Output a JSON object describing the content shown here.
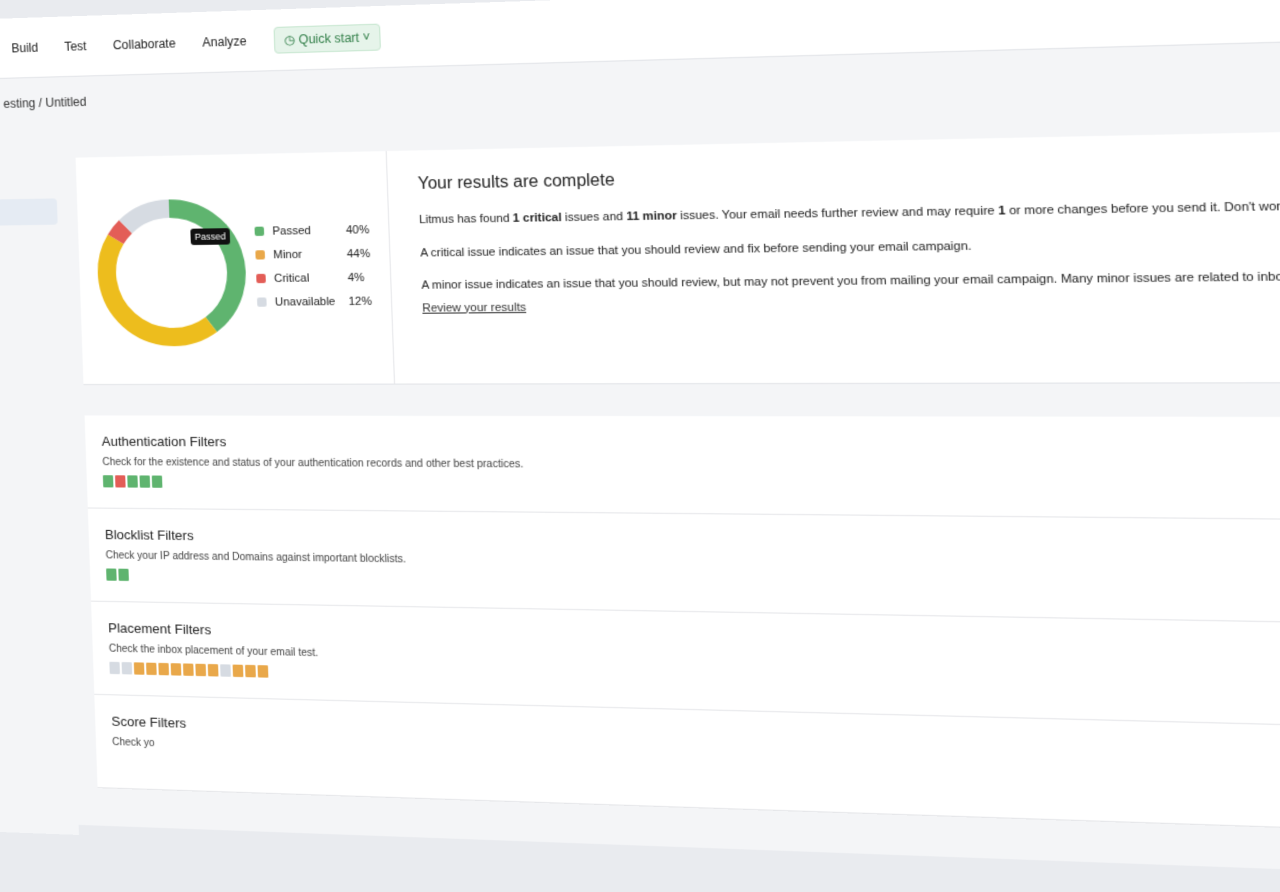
{
  "nav": {
    "items": [
      "Build",
      "Test",
      "Collaborate",
      "Analyze"
    ],
    "quick_start": "Quick start"
  },
  "breadcrumb": "esting / Untitled",
  "colors": {
    "passed": "#5fb46f",
    "minor": "#e9a84a",
    "critical": "#e35d57",
    "unavailable": "#d6dbe2",
    "donut_minor": "#edbd1d"
  },
  "chart_data": {
    "type": "pie",
    "donut": true,
    "categories": [
      "Passed",
      "Minor",
      "Critical",
      "Unavailable"
    ],
    "values": [
      40,
      44,
      4,
      12
    ],
    "labels": [
      "40%",
      "44%",
      "4%",
      "12%"
    ],
    "tooltip": "Passed"
  },
  "results": {
    "title": "Your results are complete",
    "p1_a": "Litmus has found ",
    "p1_b": "1 critical",
    "p1_c": " issues and ",
    "p1_d": "11 minor",
    "p1_e": " issues. Your email needs further review and may require ",
    "p1_f": "1",
    "p1_g": " or more changes before you send it. Don't worry—we'll take y",
    "p2": "A critical issue indicates an issue that you should review and fix before sending your email campaign.",
    "p3": "A minor issue indicates an issue that you should review, but may not prevent you from mailing your email campaign. Many minor issues are related to inbox placemen",
    "link": "Review your results"
  },
  "filters": [
    {
      "title": "Authentication Filters",
      "desc": "Check for the existence and status of your authentication records and other best practices.",
      "cells": [
        "passed",
        "critical",
        "passed",
        "passed",
        "passed"
      ]
    },
    {
      "title": "Blocklist Filters",
      "desc": "Check your IP address and Domains against important blocklists.",
      "cells": [
        "passed",
        "passed"
      ]
    },
    {
      "title": "Placement Filters",
      "desc": "Check the inbox placement of your email test.",
      "cells": [
        "unavailable",
        "unavailable",
        "minor",
        "minor",
        "minor",
        "minor",
        "minor",
        "minor",
        "minor",
        "unavailable",
        "minor",
        "minor",
        "minor"
      ]
    },
    {
      "title": "Score Filters",
      "desc": "Check yo",
      "cells": []
    }
  ]
}
